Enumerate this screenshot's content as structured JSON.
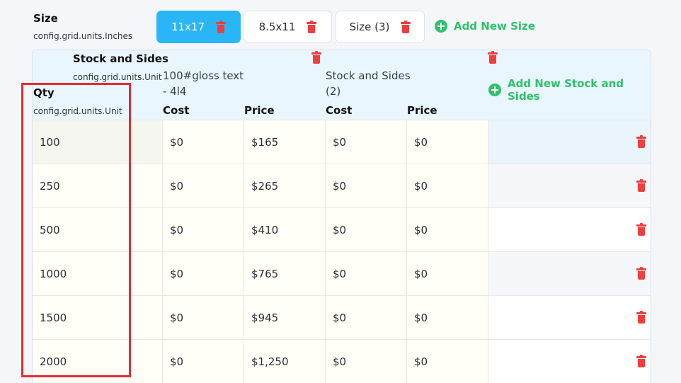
{
  "size_section": {
    "title": "Size",
    "unit": "config.grid.units.Inches",
    "tabs": [
      {
        "label": "11x17",
        "active": true
      },
      {
        "label": "8.5x11",
        "active": false
      },
      {
        "label": "Size (3)",
        "active": false
      }
    ],
    "add_label": "Add New Size"
  },
  "stock_section": {
    "title": "Stock and Sides",
    "unit": "config.grid.units.Unit",
    "qty_header": "Qty",
    "qty_unit": "config.grid.units.Unit",
    "groups": [
      {
        "name_line1": "100#gloss text",
        "name_line2": "- 4l4",
        "cost_header": "Cost",
        "price_header": "Price"
      },
      {
        "name_line1": "Stock and Sides",
        "name_line2": "(2)",
        "cost_header": "Cost",
        "price_header": "Price"
      }
    ],
    "add_label": "Add New Stock and Sides"
  },
  "rows": [
    {
      "qty": "100",
      "cost1": "$0",
      "price1": "$165",
      "cost2": "$0",
      "price2": "$0"
    },
    {
      "qty": "250",
      "cost1": "$0",
      "price1": "$265",
      "cost2": "$0",
      "price2": "$0"
    },
    {
      "qty": "500",
      "cost1": "$0",
      "price1": "$410",
      "cost2": "$0",
      "price2": "$0"
    },
    {
      "qty": "1000",
      "cost1": "$0",
      "price1": "$765",
      "cost2": "$0",
      "price2": "$0"
    },
    {
      "qty": "1500",
      "cost1": "$0",
      "price1": "$945",
      "cost2": "$0",
      "price2": "$0"
    },
    {
      "qty": "2000",
      "cost1": "$0",
      "price1": "$1,250",
      "cost2": "$0",
      "price2": "$0"
    }
  ],
  "colors": {
    "accent": "#29b6f6",
    "add_green": "#2ec26b",
    "delete_red": "#ee3e3e",
    "highlight_red": "#e32d36",
    "header_bg": "#e9f6fd"
  }
}
